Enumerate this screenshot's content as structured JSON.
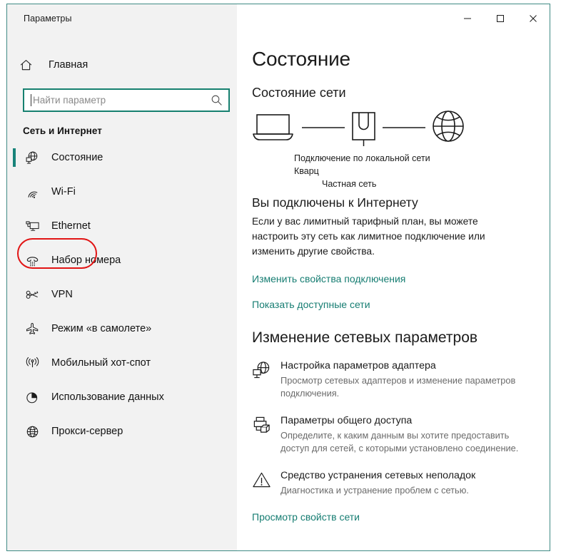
{
  "window": {
    "app_title": "Параметры",
    "accent_color": "#16806f",
    "annotation_color": "#e11414",
    "caption": {
      "minimize": "minimize-icon",
      "maximize": "maximize-icon",
      "close": "close-icon"
    }
  },
  "sidebar": {
    "home_label": "Главная",
    "home_icon": "home-icon",
    "search": {
      "placeholder": "Найти параметр",
      "value": "",
      "icon": "search-icon"
    },
    "group_title": "Сеть и Интернет",
    "items": [
      {
        "label": "Состояние",
        "icon": "network-status-icon",
        "selected": true,
        "annotated": false
      },
      {
        "label": "Wi-Fi",
        "icon": "wifi-icon",
        "selected": false,
        "annotated": false
      },
      {
        "label": "Ethernet",
        "icon": "ethernet-icon",
        "selected": false,
        "annotated": true
      },
      {
        "label": "Набор номера",
        "icon": "dialup-phone-icon",
        "selected": false,
        "annotated": false
      },
      {
        "label": "VPN",
        "icon": "vpn-key-icon",
        "selected": false,
        "annotated": false
      },
      {
        "label": "Режим «в самолете»",
        "icon": "airplane-icon",
        "selected": false,
        "annotated": false
      },
      {
        "label": "Мобильный хот-спот",
        "icon": "hotspot-icon",
        "selected": false,
        "annotated": false
      },
      {
        "label": "Использование данных",
        "icon": "pie-chart-icon",
        "selected": false,
        "annotated": false
      },
      {
        "label": "Прокси-сервер",
        "icon": "globe-icon",
        "selected": false,
        "annotated": false
      }
    ]
  },
  "main": {
    "page_title": "Состояние",
    "status_subtitle": "Состояние сети",
    "diagram": {
      "device_icon": "laptop-icon",
      "adapter_icon": "network-adapter-icon",
      "internet_icon": "globe-icon",
      "connection_label": "Подключение по локальной сети",
      "network_name": "Кварц",
      "network_type": "Частная сеть"
    },
    "connected_heading": "Вы подключены к Интернету",
    "connected_description": "Если у вас лимитный тарифный план, вы можете настроить эту сеть как лимитное подключение или изменить другие свойства.",
    "links": [
      {
        "label": "Изменить свойства подключения"
      },
      {
        "label": "Показать доступные сети"
      }
    ],
    "change_params_title": "Изменение сетевых параметров",
    "settings_rows": [
      {
        "icon": "adapter-settings-icon",
        "title": "Настройка параметров адаптера",
        "description": "Просмотр сетевых адаптеров и изменение параметров подключения."
      },
      {
        "icon": "sharing-options-icon",
        "title": "Параметры общего доступа",
        "description": "Определите, к каким данным вы хотите предоставить доступ для сетей, с которыми установлено соединение."
      },
      {
        "icon": "troubleshoot-warning-icon",
        "title": "Средство устранения сетевых неполадок",
        "description": "Диагностика и устранение проблем с сетью."
      }
    ],
    "bottom_link": {
      "label": "Просмотр свойств сети"
    }
  }
}
